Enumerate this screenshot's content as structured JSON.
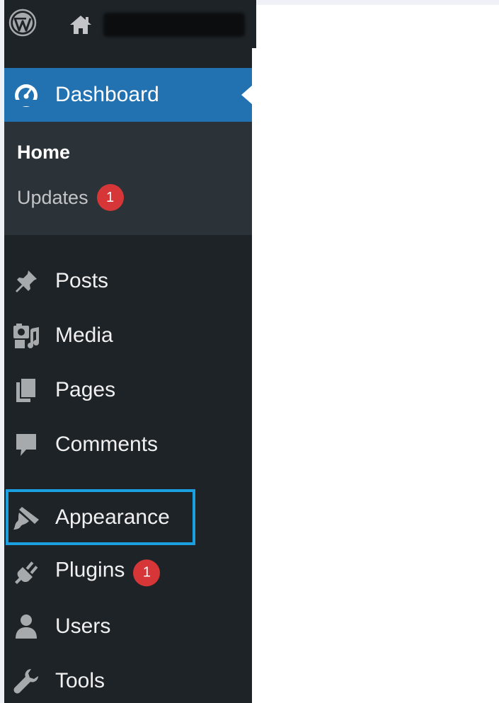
{
  "admin_bar": {
    "logo_icon": "wordpress-logo-icon",
    "home_icon": "home-icon"
  },
  "sidebar": {
    "dashboard": {
      "label": "Dashboard",
      "icon": "dashboard-gauge-icon",
      "active": true
    },
    "submenu": {
      "home": "Home",
      "updates": "Updates",
      "updates_badge": "1"
    },
    "items": [
      {
        "label": "Posts",
        "icon": "pushpin-icon"
      },
      {
        "label": "Media",
        "icon": "media-icon"
      },
      {
        "label": "Pages",
        "icon": "pages-icon"
      },
      {
        "label": "Comments",
        "icon": "comment-icon"
      },
      {
        "label": "Appearance",
        "icon": "paintbrush-icon",
        "highlighted": true
      },
      {
        "label": "Plugins",
        "icon": "plugin-icon",
        "badge": "1"
      },
      {
        "label": "Users",
        "icon": "user-icon"
      },
      {
        "label": "Tools",
        "icon": "wrench-icon"
      }
    ]
  },
  "colors": {
    "sidebar_bg": "#1d2327",
    "submenu_bg": "#2c3338",
    "active_bg": "#2271b1",
    "badge_bg": "#d63638",
    "highlight_border": "#1aa0e0"
  }
}
